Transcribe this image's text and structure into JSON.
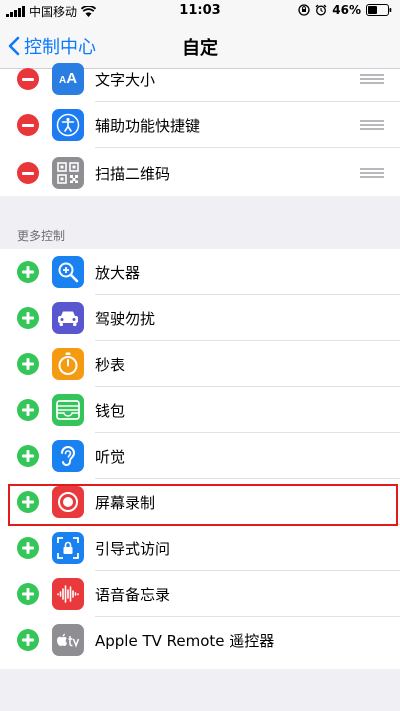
{
  "status_bar": {
    "carrier": "中国移动",
    "time": "11:03",
    "battery": "46%"
  },
  "nav": {
    "back_label": "控制中心",
    "title": "自定"
  },
  "included": [
    {
      "label": "文字大小",
      "icon": "text-size-icon"
    },
    {
      "label": "辅助功能快捷键",
      "icon": "accessibility-icon"
    },
    {
      "label": "扫描二维码",
      "icon": "qr-code-icon"
    }
  ],
  "more_controls": {
    "header": "更多控制",
    "items": [
      {
        "label": "放大器",
        "icon": "magnifier-icon"
      },
      {
        "label": "驾驶勿扰",
        "icon": "car-icon"
      },
      {
        "label": "秒表",
        "icon": "stopwatch-icon"
      },
      {
        "label": "钱包",
        "icon": "wallet-icon"
      },
      {
        "label": "听觉",
        "icon": "ear-icon"
      },
      {
        "label": "屏幕录制",
        "icon": "screen-record-icon"
      },
      {
        "label": "引导式访问",
        "icon": "guided-access-icon"
      },
      {
        "label": "语音备忘录",
        "icon": "voice-memo-icon"
      },
      {
        "label": "Apple TV Remote 遥控器",
        "icon": "apple-tv-icon"
      }
    ]
  },
  "colors": {
    "remove": "#e8363b",
    "add": "#35c659",
    "accent": "#0a7aff",
    "highlight": "#e21b1b"
  }
}
